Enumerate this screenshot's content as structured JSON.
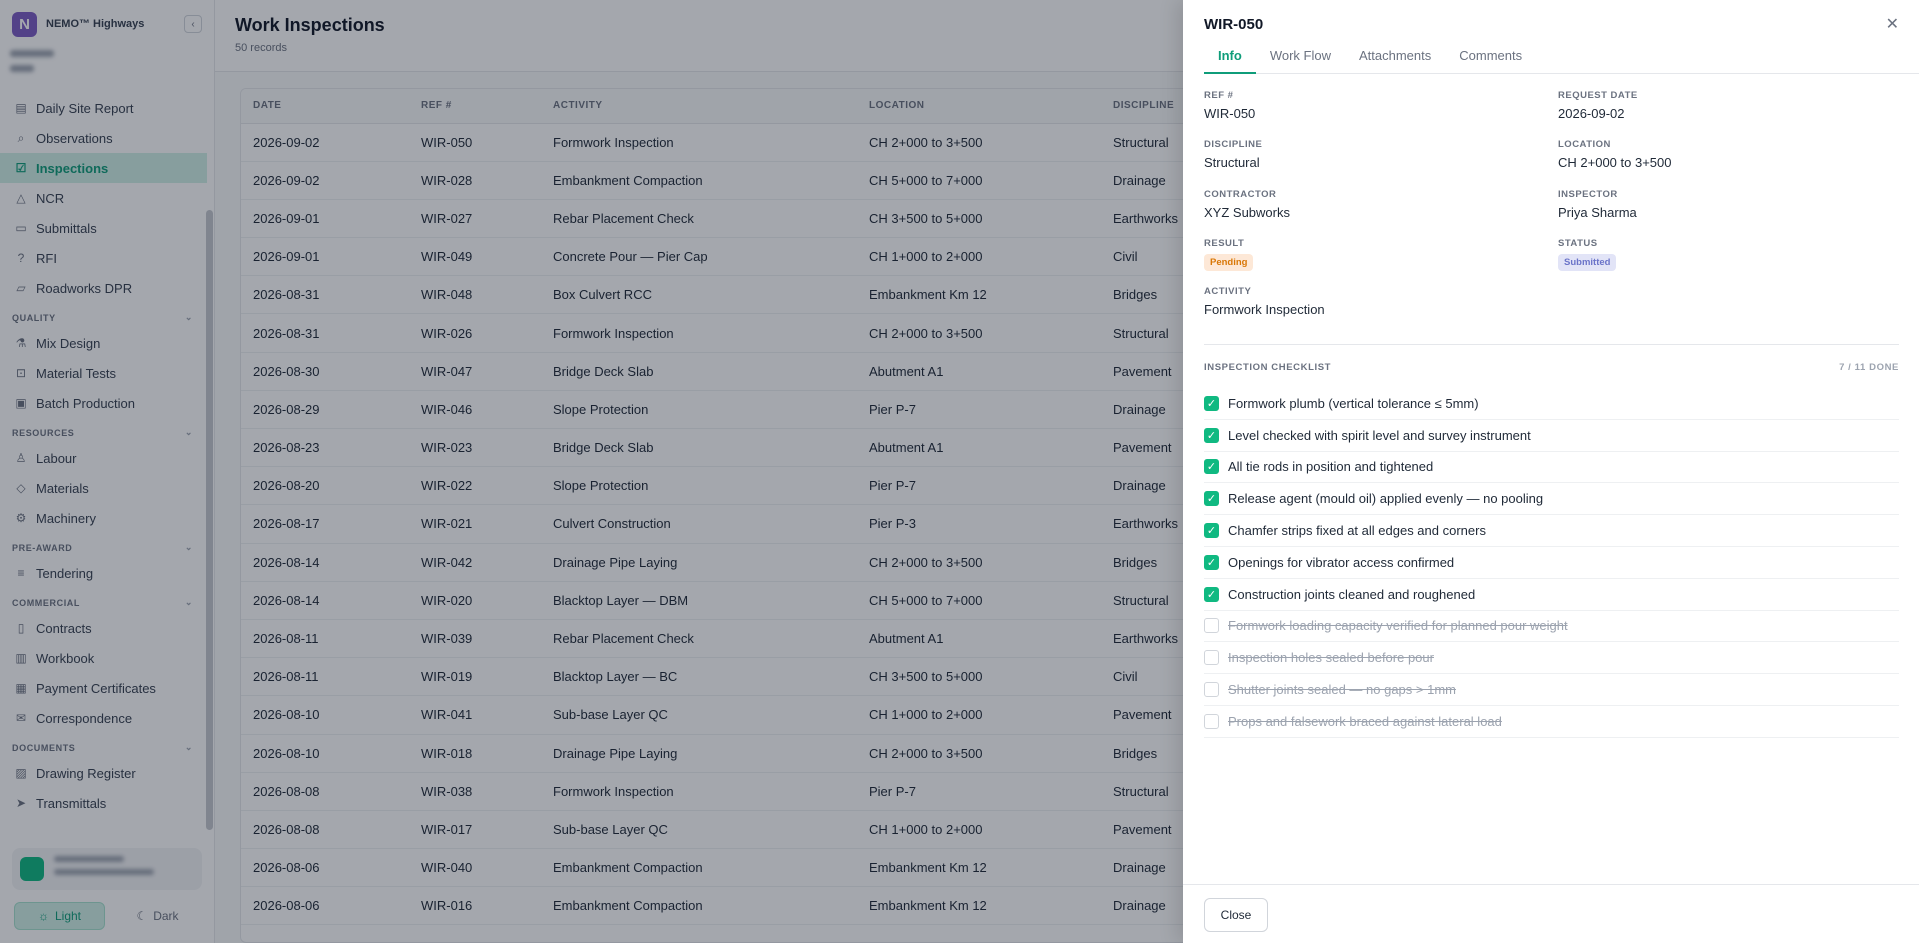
{
  "app": {
    "brand_name": "NEMO™ Highways",
    "brand_initial": "N",
    "accent_color": "#0f9d7a"
  },
  "sidebar": {
    "items_top": [
      {
        "label": "Daily Site Report",
        "icon": "report-icon"
      },
      {
        "label": "Observations",
        "icon": "search-icon"
      },
      {
        "label": "Inspections",
        "icon": "checkbox-icon",
        "active": true
      },
      {
        "label": "NCR",
        "icon": "warning-icon"
      },
      {
        "label": "Submittals",
        "icon": "inbox-icon"
      },
      {
        "label": "RFI",
        "icon": "question-icon"
      },
      {
        "label": "Roadworks DPR",
        "icon": "chart-icon"
      }
    ],
    "quality_label": "QUALITY",
    "quality_items": [
      {
        "label": "Mix Design",
        "icon": "flask-icon"
      },
      {
        "label": "Material Tests",
        "icon": "test-icon"
      },
      {
        "label": "Batch Production",
        "icon": "box-icon"
      }
    ],
    "resources_label": "RESOURCES",
    "resources_items": [
      {
        "label": "Labour",
        "icon": "user-icon"
      },
      {
        "label": "Materials",
        "icon": "cube-icon"
      },
      {
        "label": "Machinery",
        "icon": "gear-icon"
      }
    ],
    "preaward_label": "PRE-AWARD",
    "preaward_items": [
      {
        "label": "Tendering",
        "icon": "list-icon"
      }
    ],
    "commercial_label": "COMMERCIAL",
    "commercial_items": [
      {
        "label": "Contracts",
        "icon": "document-icon"
      },
      {
        "label": "Workbook",
        "icon": "book-icon"
      },
      {
        "label": "Payment Certificates",
        "icon": "certificate-icon"
      },
      {
        "label": "Correspondence",
        "icon": "mail-icon"
      }
    ],
    "documents_label": "DOCUMENTS",
    "documents_items": [
      {
        "label": "Drawing Register",
        "icon": "image-icon"
      },
      {
        "label": "Transmittals",
        "icon": "send-icon"
      }
    ],
    "theme_light": "Light",
    "theme_dark": "Dark"
  },
  "page": {
    "title": "Work Inspections",
    "subtitle": "50 records"
  },
  "table": {
    "headers": [
      "DATE",
      "REF #",
      "ACTIVITY",
      "LOCATION",
      "DISCIPLINE"
    ],
    "rows": [
      [
        "2026-09-02",
        "WIR-050",
        "Formwork Inspection",
        "CH 2+000 to 3+500",
        "Structural"
      ],
      [
        "2026-09-02",
        "WIR-028",
        "Embankment Compaction",
        "CH 5+000 to 7+000",
        "Drainage"
      ],
      [
        "2026-09-01",
        "WIR-027",
        "Rebar Placement Check",
        "CH 3+500 to 5+000",
        "Earthworks"
      ],
      [
        "2026-09-01",
        "WIR-049",
        "Concrete Pour — Pier Cap",
        "CH 1+000 to 2+000",
        "Civil"
      ],
      [
        "2026-08-31",
        "WIR-048",
        "Box Culvert RCC",
        "Embankment Km 12",
        "Bridges"
      ],
      [
        "2026-08-31",
        "WIR-026",
        "Formwork Inspection",
        "CH 2+000 to 3+500",
        "Structural"
      ],
      [
        "2026-08-30",
        "WIR-047",
        "Bridge Deck Slab",
        "Abutment A1",
        "Pavement"
      ],
      [
        "2026-08-29",
        "WIR-046",
        "Slope Protection",
        "Pier P-7",
        "Drainage"
      ],
      [
        "2026-08-23",
        "WIR-023",
        "Bridge Deck Slab",
        "Abutment A1",
        "Pavement"
      ],
      [
        "2026-08-20",
        "WIR-022",
        "Slope Protection",
        "Pier P-7",
        "Drainage"
      ],
      [
        "2026-08-17",
        "WIR-021",
        "Culvert Construction",
        "Pier P-3",
        "Earthworks"
      ],
      [
        "2026-08-14",
        "WIR-042",
        "Drainage Pipe Laying",
        "CH 2+000 to 3+500",
        "Bridges"
      ],
      [
        "2026-08-14",
        "WIR-020",
        "Blacktop Layer — DBM",
        "CH 5+000 to 7+000",
        "Structural"
      ],
      [
        "2026-08-11",
        "WIR-039",
        "Rebar Placement Check",
        "Abutment A1",
        "Earthworks"
      ],
      [
        "2026-08-11",
        "WIR-019",
        "Blacktop Layer — BC",
        "CH 3+500 to 5+000",
        "Civil"
      ],
      [
        "2026-08-10",
        "WIR-041",
        "Sub-base Layer QC",
        "CH 1+000 to 2+000",
        "Pavement"
      ],
      [
        "2026-08-10",
        "WIR-018",
        "Drainage Pipe Laying",
        "CH 2+000 to 3+500",
        "Bridges"
      ],
      [
        "2026-08-08",
        "WIR-038",
        "Formwork Inspection",
        "Pier P-7",
        "Structural"
      ],
      [
        "2026-08-08",
        "WIR-017",
        "Sub-base Layer QC",
        "CH 1+000 to 2+000",
        "Pavement"
      ],
      [
        "2026-08-06",
        "WIR-040",
        "Embankment Compaction",
        "Embankment Km 12",
        "Drainage"
      ],
      [
        "2026-08-06",
        "WIR-016",
        "Embankment Compaction",
        "Embankment Km 12",
        "Drainage"
      ]
    ]
  },
  "drawer": {
    "title": "WIR-050",
    "tabs": [
      "Info",
      "Work Flow",
      "Attachments",
      "Comments"
    ],
    "fields": {
      "ref_label": "REF #",
      "ref_value": "WIR-050",
      "request_date_label": "REQUEST DATE",
      "request_date_value": "2026-09-02",
      "discipline_label": "DISCIPLINE",
      "discipline_value": "Structural",
      "location_label": "LOCATION",
      "location_value": "CH 2+000 to 3+500",
      "contractor_label": "CONTRACTOR",
      "contractor_value": "XYZ Subworks",
      "inspector_label": "INSPECTOR",
      "inspector_value": "Priya Sharma",
      "result_label": "RESULT",
      "result_value": "Pending",
      "status_label": "STATUS",
      "status_value": "Submitted",
      "activity_label": "ACTIVITY",
      "activity_value": "Formwork Inspection"
    },
    "checklist_title": "INSPECTION CHECKLIST",
    "checklist_count": "7 / 11 DONE",
    "checklist": [
      {
        "text": "Formwork plumb (vertical tolerance ≤ 5mm)",
        "done": true
      },
      {
        "text": "Level checked with spirit level and survey instrument",
        "done": true
      },
      {
        "text": "All tie rods in position and tightened",
        "done": true
      },
      {
        "text": "Release agent (mould oil) applied evenly — no pooling",
        "done": true
      },
      {
        "text": "Chamfer strips fixed at all edges and corners",
        "done": true
      },
      {
        "text": "Openings for vibrator access confirmed",
        "done": true
      },
      {
        "text": "Construction joints cleaned and roughened",
        "done": true
      },
      {
        "text": "Formwork loading capacity verified for planned pour weight",
        "done": false
      },
      {
        "text": "Inspection holes sealed before pour",
        "done": false
      },
      {
        "text": "Shutter joints sealed — no gaps > 1mm",
        "done": false
      },
      {
        "text": "Props and falsework braced against lateral load",
        "done": false
      }
    ],
    "close_label": "Close"
  }
}
